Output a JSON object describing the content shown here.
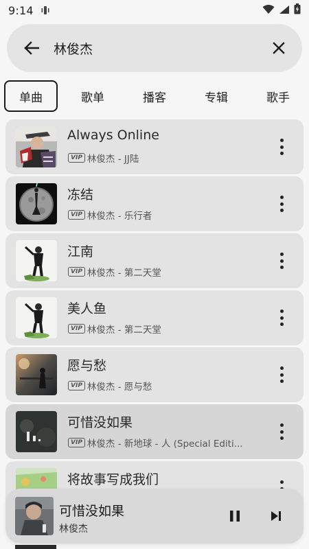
{
  "status_bar": {
    "time": "9:14"
  },
  "search": {
    "query": "林俊杰",
    "back_icon": "arrow-left-icon",
    "clear_icon": "close-icon"
  },
  "tabs": [
    {
      "label": "单曲",
      "active": true
    },
    {
      "label": "歌单",
      "active": false
    },
    {
      "label": "播客",
      "active": false
    },
    {
      "label": "专辑",
      "active": false
    },
    {
      "label": "歌手",
      "active": false
    }
  ],
  "badge": "VIP",
  "songs": [
    {
      "title": "Always Online",
      "subtitle": "林俊杰 - JJ陆"
    },
    {
      "title": "冻结",
      "subtitle": "林俊杰 - 乐行者"
    },
    {
      "title": "江南",
      "subtitle": "林俊杰 - 第二天堂"
    },
    {
      "title": "美人鱼",
      "subtitle": "林俊杰 - 第二天堂"
    },
    {
      "title": "愿与愁",
      "subtitle": "林俊杰 - 愿与愁"
    },
    {
      "title": "可惜没如果",
      "subtitle": "林俊杰 - 新地球 - 人 (Special Editi..."
    },
    {
      "title": "将故事写成我们",
      "subtitle": ""
    }
  ],
  "now_playing": {
    "title": "可惜没如果",
    "artist": "林俊杰",
    "pause_icon": "pause-icon",
    "next_icon": "skip-next-icon"
  },
  "colors": {
    "background": "#f6f6f6",
    "card": "#e3e3e3",
    "card_selected": "#d6d6d6",
    "search_bg": "#e4e4e4",
    "player_bg": "#d9d9d9",
    "text": "#1e1e1e"
  }
}
